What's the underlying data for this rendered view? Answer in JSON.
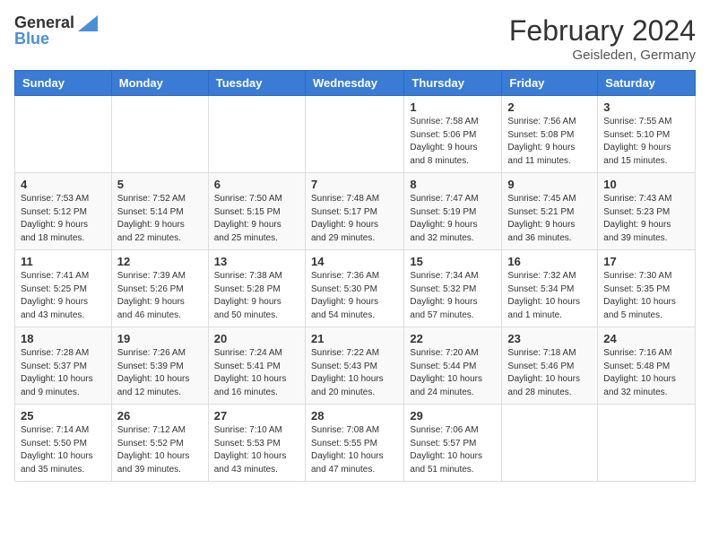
{
  "header": {
    "logo_line1": "General",
    "logo_line2": "Blue",
    "month_year": "February 2024",
    "location": "Geisleden, Germany"
  },
  "weekdays": [
    "Sunday",
    "Monday",
    "Tuesday",
    "Wednesday",
    "Thursday",
    "Friday",
    "Saturday"
  ],
  "weeks": [
    [
      {
        "day": "",
        "info": ""
      },
      {
        "day": "",
        "info": ""
      },
      {
        "day": "",
        "info": ""
      },
      {
        "day": "",
        "info": ""
      },
      {
        "day": "1",
        "info": "Sunrise: 7:58 AM\nSunset: 5:06 PM\nDaylight: 9 hours\nand 8 minutes."
      },
      {
        "day": "2",
        "info": "Sunrise: 7:56 AM\nSunset: 5:08 PM\nDaylight: 9 hours\nand 11 minutes."
      },
      {
        "day": "3",
        "info": "Sunrise: 7:55 AM\nSunset: 5:10 PM\nDaylight: 9 hours\nand 15 minutes."
      }
    ],
    [
      {
        "day": "4",
        "info": "Sunrise: 7:53 AM\nSunset: 5:12 PM\nDaylight: 9 hours\nand 18 minutes."
      },
      {
        "day": "5",
        "info": "Sunrise: 7:52 AM\nSunset: 5:14 PM\nDaylight: 9 hours\nand 22 minutes."
      },
      {
        "day": "6",
        "info": "Sunrise: 7:50 AM\nSunset: 5:15 PM\nDaylight: 9 hours\nand 25 minutes."
      },
      {
        "day": "7",
        "info": "Sunrise: 7:48 AM\nSunset: 5:17 PM\nDaylight: 9 hours\nand 29 minutes."
      },
      {
        "day": "8",
        "info": "Sunrise: 7:47 AM\nSunset: 5:19 PM\nDaylight: 9 hours\nand 32 minutes."
      },
      {
        "day": "9",
        "info": "Sunrise: 7:45 AM\nSunset: 5:21 PM\nDaylight: 9 hours\nand 36 minutes."
      },
      {
        "day": "10",
        "info": "Sunrise: 7:43 AM\nSunset: 5:23 PM\nDaylight: 9 hours\nand 39 minutes."
      }
    ],
    [
      {
        "day": "11",
        "info": "Sunrise: 7:41 AM\nSunset: 5:25 PM\nDaylight: 9 hours\nand 43 minutes."
      },
      {
        "day": "12",
        "info": "Sunrise: 7:39 AM\nSunset: 5:26 PM\nDaylight: 9 hours\nand 46 minutes."
      },
      {
        "day": "13",
        "info": "Sunrise: 7:38 AM\nSunset: 5:28 PM\nDaylight: 9 hours\nand 50 minutes."
      },
      {
        "day": "14",
        "info": "Sunrise: 7:36 AM\nSunset: 5:30 PM\nDaylight: 9 hours\nand 54 minutes."
      },
      {
        "day": "15",
        "info": "Sunrise: 7:34 AM\nSunset: 5:32 PM\nDaylight: 9 hours\nand 57 minutes."
      },
      {
        "day": "16",
        "info": "Sunrise: 7:32 AM\nSunset: 5:34 PM\nDaylight: 10 hours\nand 1 minute."
      },
      {
        "day": "17",
        "info": "Sunrise: 7:30 AM\nSunset: 5:35 PM\nDaylight: 10 hours\nand 5 minutes."
      }
    ],
    [
      {
        "day": "18",
        "info": "Sunrise: 7:28 AM\nSunset: 5:37 PM\nDaylight: 10 hours\nand 9 minutes."
      },
      {
        "day": "19",
        "info": "Sunrise: 7:26 AM\nSunset: 5:39 PM\nDaylight: 10 hours\nand 12 minutes."
      },
      {
        "day": "20",
        "info": "Sunrise: 7:24 AM\nSunset: 5:41 PM\nDaylight: 10 hours\nand 16 minutes."
      },
      {
        "day": "21",
        "info": "Sunrise: 7:22 AM\nSunset: 5:43 PM\nDaylight: 10 hours\nand 20 minutes."
      },
      {
        "day": "22",
        "info": "Sunrise: 7:20 AM\nSunset: 5:44 PM\nDaylight: 10 hours\nand 24 minutes."
      },
      {
        "day": "23",
        "info": "Sunrise: 7:18 AM\nSunset: 5:46 PM\nDaylight: 10 hours\nand 28 minutes."
      },
      {
        "day": "24",
        "info": "Sunrise: 7:16 AM\nSunset: 5:48 PM\nDaylight: 10 hours\nand 32 minutes."
      }
    ],
    [
      {
        "day": "25",
        "info": "Sunrise: 7:14 AM\nSunset: 5:50 PM\nDaylight: 10 hours\nand 35 minutes."
      },
      {
        "day": "26",
        "info": "Sunrise: 7:12 AM\nSunset: 5:52 PM\nDaylight: 10 hours\nand 39 minutes."
      },
      {
        "day": "27",
        "info": "Sunrise: 7:10 AM\nSunset: 5:53 PM\nDaylight: 10 hours\nand 43 minutes."
      },
      {
        "day": "28",
        "info": "Sunrise: 7:08 AM\nSunset: 5:55 PM\nDaylight: 10 hours\nand 47 minutes."
      },
      {
        "day": "29",
        "info": "Sunrise: 7:06 AM\nSunset: 5:57 PM\nDaylight: 10 hours\nand 51 minutes."
      },
      {
        "day": "",
        "info": ""
      },
      {
        "day": "",
        "info": ""
      }
    ]
  ]
}
